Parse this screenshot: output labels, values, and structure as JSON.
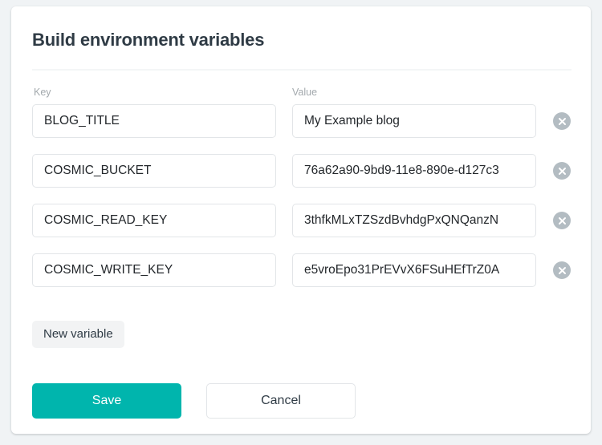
{
  "card": {
    "title": "Build environment variables",
    "columns": {
      "key_label": "Key",
      "value_label": "Value"
    },
    "variables": [
      {
        "key": "BLOG_TITLE",
        "value": "My Example blog",
        "remove_icon": "close-circle-icon"
      },
      {
        "key": "COSMIC_BUCKET",
        "value": "76a62a90-9bd9-11e8-890e-d127c3",
        "remove_icon": "close-circle-icon"
      },
      {
        "key": "COSMIC_READ_KEY",
        "value": "3thfkMLxTZSzdBvhdgPxQNQanzN",
        "remove_icon": "close-circle-icon"
      },
      {
        "key": "COSMIC_WRITE_KEY",
        "value": "e5vroEpo31PrEVvX6FSuHEfTrZ0A",
        "remove_icon": "close-circle-icon"
      }
    ],
    "new_variable_label": "New variable",
    "save_label": "Save",
    "cancel_label": "Cancel"
  },
  "colors": {
    "accent": "#00b5ad",
    "page_background": "#f0f3f5",
    "card_background": "#ffffff",
    "label_text": "#a3a9ad",
    "body_text": "#2f3b45",
    "field_border": "#e2e5e8",
    "remove_button": "#b3bcc2"
  }
}
